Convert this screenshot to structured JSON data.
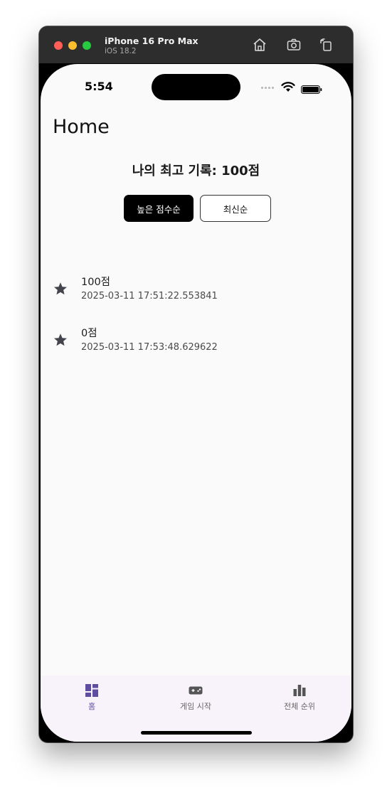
{
  "simulator": {
    "device_name": "iPhone 16 Pro Max",
    "os_version": "iOS 18.2",
    "toolbar_icons": [
      "home-icon",
      "screenshot-icon",
      "rotate-icon"
    ]
  },
  "status_bar": {
    "time": "5:54",
    "icons": [
      "signal-dots-icon",
      "wifi-icon",
      "battery-icon"
    ]
  },
  "page": {
    "title": "Home",
    "best_score": "나의 최고 기록: 100점"
  },
  "sort_buttons": {
    "high_score": "높은 점수순",
    "latest": "최신순",
    "selected": "높은 점수순"
  },
  "records": [
    {
      "score": "100점",
      "date": "2025-03-11 17:51:22.553841",
      "icon": "star-icon"
    },
    {
      "score": "0점",
      "date": "2025-03-11 17:53:48.629622",
      "icon": "star-icon"
    }
  ],
  "nav": {
    "items": [
      {
        "label": "홈",
        "icon": "dashboard-icon",
        "active": true
      },
      {
        "label": "게임 시작",
        "icon": "gamepad-icon",
        "active": false
      },
      {
        "label": "전체 순위",
        "icon": "bar-chart-icon",
        "active": false
      }
    ]
  },
  "colors": {
    "accent": "#5e4ea0",
    "nav_background": "#f8f3fb",
    "screen_background": "#fafafa",
    "active_button": "#000000"
  }
}
